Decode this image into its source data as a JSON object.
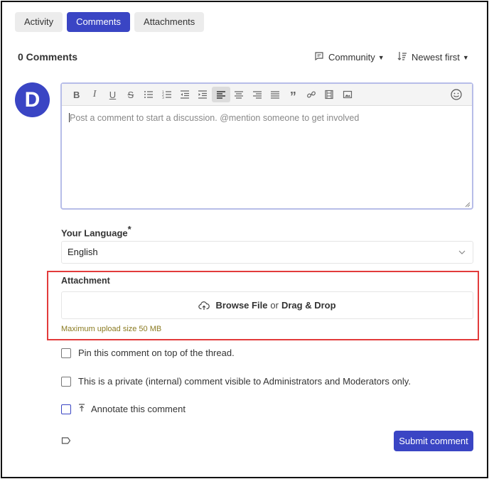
{
  "tabs": [
    {
      "label": "Activity",
      "active": false
    },
    {
      "label": "Comments",
      "active": true
    },
    {
      "label": "Attachments",
      "active": false
    }
  ],
  "header": {
    "comments_count": "0 Comments",
    "visibility_filter": "Community",
    "sort_filter": "Newest first"
  },
  "avatar": {
    "initial": "D",
    "color": "#3a45c4"
  },
  "editor": {
    "placeholder": "Post a comment to start a discussion. @mention someone to get involved",
    "toolbar": [
      "bold-icon",
      "italic-icon",
      "underline-icon",
      "strikethrough-icon",
      "bullet-list-icon",
      "numbered-list-icon",
      "outdent-icon",
      "indent-icon",
      "align-left-icon",
      "align-center-icon",
      "align-right-icon",
      "justify-icon",
      "quote-icon",
      "link-icon",
      "media-icon",
      "image-icon",
      "emoji-icon"
    ]
  },
  "language": {
    "label": "Your Language",
    "required_mark": "*",
    "value": "English"
  },
  "attachment": {
    "label": "Attachment",
    "browse": "Browse File",
    "or": "or",
    "drag": "Drag & Drop",
    "hint": "Maximum upload size 50 MB"
  },
  "options": {
    "pin": "Pin this comment on top of the thread.",
    "private": "This is a private (internal) comment visible to Administrators and Moderators only.",
    "annotate": "Annotate this comment"
  },
  "submit_label": "Submit comment",
  "colors": {
    "accent": "#3a45c4",
    "highlight_border": "#e23b3b",
    "hint": "#8a7a20"
  }
}
